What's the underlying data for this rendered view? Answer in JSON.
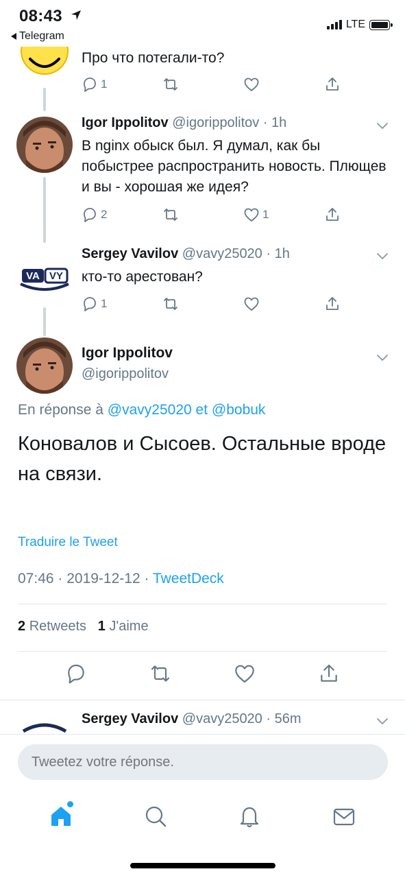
{
  "status_bar": {
    "time": "08:43",
    "back_app": "Telegram",
    "network": "LTE"
  },
  "tweets": [
    {
      "text": "Про что потегали-то?",
      "reply_count": "1",
      "retweet_count": "",
      "like_count": ""
    },
    {
      "name": "Igor Ippolitov",
      "handle_time": "@igorippolitov · 1h",
      "text": "В nginx обыск был. Я думал, как бы побыстрее распространить новость. Плющев и вы - хорошая же идея?",
      "reply_count": "2",
      "retweet_count": "",
      "like_count": "1"
    },
    {
      "name": "Sergey Vavilov",
      "handle_time": "@vavy25020 · 1h",
      "avatar_text_left": "VA",
      "avatar_text_right": "VY",
      "text": "кто-то арестован?",
      "reply_count": "1",
      "retweet_count": "",
      "like_count": ""
    }
  ],
  "main_tweet": {
    "name": "Igor Ippolitov",
    "handle": "@igorippolitov",
    "reply_prefix": "En réponse à",
    "reply_user1": "@vavy25020",
    "reply_and": "et",
    "reply_user2": "@bobuk",
    "text": "Коновалов и Сысоев. Остальные вроде на связи.",
    "translate": "Traduire le Tweet",
    "time": "07:46 · 2019-12-12 ·",
    "source": "TweetDeck",
    "retweets_count": "2",
    "retweets_label": "Retweets",
    "likes_count": "1",
    "likes_label": "J'aime"
  },
  "next_tweet": {
    "name": "Sergey Vavilov",
    "handle_time": "@vavy25020 · 56m"
  },
  "composer": {
    "placeholder": "Tweetez votre réponse."
  },
  "tabs": [
    "home",
    "search",
    "notifications",
    "messages"
  ],
  "colors": {
    "accent": "#1da1f2",
    "muted": "#657786",
    "divider": "#e1e8ed"
  }
}
